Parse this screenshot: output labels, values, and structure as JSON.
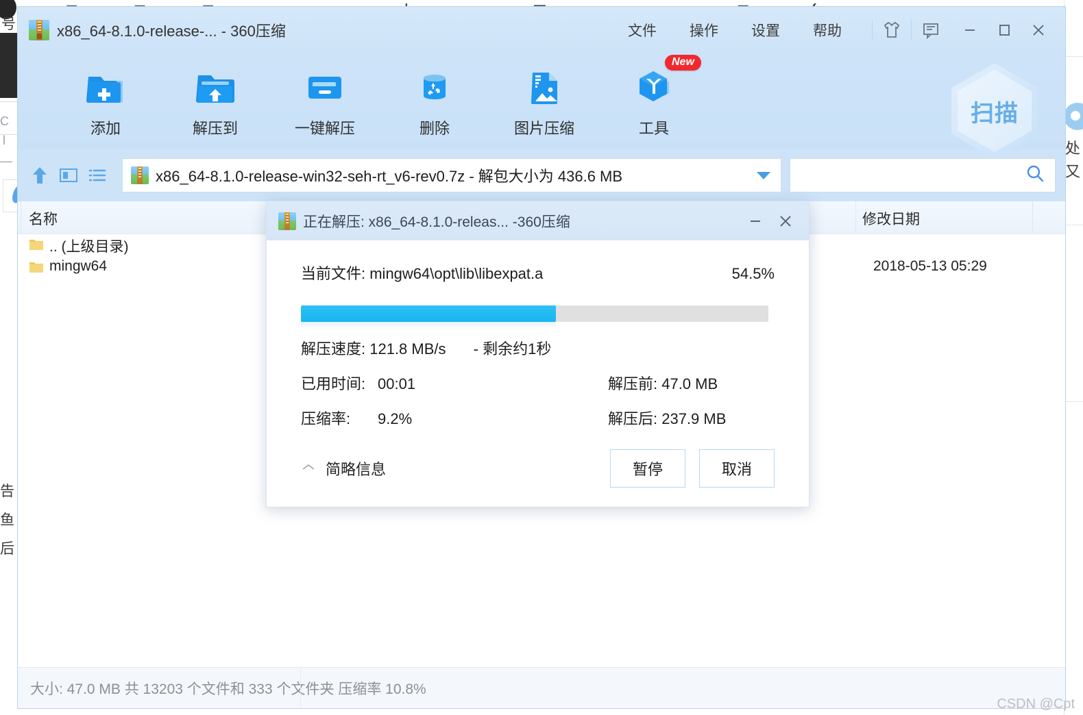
{
  "background": {
    "left_fragments": [
      "号",
      "C",
      "l",
      "—",
      "告",
      "鱼",
      "后"
    ],
    "right_fragments": [
      "处",
      "又"
    ],
    "top_glyph_row": "⌐ ⊓ ⊓ ⊓ ∧ ∧ ǀ ⊿ ⊞ ∧ ∧ ⊓ ∠"
  },
  "window": {
    "title": "x86_64-8.1.0-release-... - 360压缩",
    "app_icon": "archive-icon",
    "menu": [
      {
        "label": "文件",
        "name": "menu-file"
      },
      {
        "label": "操作",
        "name": "menu-action"
      },
      {
        "label": "设置",
        "name": "menu-settings"
      },
      {
        "label": "帮助",
        "name": "menu-help"
      }
    ],
    "title_icons": [
      {
        "name": "skin-icon",
        "glyph": "skin"
      },
      {
        "name": "feedback-icon",
        "glyph": "feedback"
      }
    ],
    "window_buttons": [
      {
        "name": "minimize-button",
        "glyph": "−"
      },
      {
        "name": "maximize-button",
        "glyph": "□"
      },
      {
        "name": "close-button",
        "glyph": "✕"
      }
    ]
  },
  "toolbar": {
    "items": [
      {
        "label": "添加",
        "icon": "folder-add-icon"
      },
      {
        "label": "解压到",
        "icon": "folder-extract-icon"
      },
      {
        "label": "一键解压",
        "icon": "one-click-extract-icon"
      },
      {
        "label": "删除",
        "icon": "recycle-bin-icon"
      },
      {
        "label": "图片压缩",
        "icon": "image-compress-icon"
      },
      {
        "label": "工具",
        "icon": "tools-hexagon-icon",
        "badge": "New"
      }
    ],
    "scan_watermark": "扫描"
  },
  "addressbar": {
    "up_icon": "up-arrow-icon",
    "view_icon": "preview-pane-icon",
    "list_icon": "list-view-icon",
    "path_text": "x86_64-8.1.0-release-win32-seh-rt_v6-rev0.7z - 解包大小为 436.6 MB",
    "path_icon": "archive-icon",
    "dropdown_icon": "chevron-down-icon",
    "search_value": "",
    "search_placeholder": "",
    "search_icon": "search-icon"
  },
  "filelist": {
    "columns": {
      "name": "名称",
      "date": "修改日期"
    },
    "rows": [
      {
        "name": ".. (上级目录)",
        "date": "",
        "icon": "folder-icon"
      },
      {
        "name": "mingw64",
        "date": "2018-05-13 05:29",
        "icon": "folder-icon"
      }
    ]
  },
  "statusbar": {
    "text": "大小: 47.0 MB 共 13203 个文件和 333 个文件夹 压缩率 10.8%"
  },
  "watermark": "CSDN @Cpt",
  "dialog": {
    "title": "正在解压: x86_64-8.1.0-releas... -360压缩",
    "icon": "archive-icon",
    "minimize": "−",
    "close": "✕",
    "current_file_label": "当前文件: mingw64\\opt\\lib\\libexpat.a",
    "percent_text": "54.5%",
    "progress_percent": 54.5,
    "progress_color": "#19b5f0",
    "speed_line": "解压速度: 121.8 MB/s",
    "remaining_line": "- 剩余约1秒",
    "elapsed_label": "已用时间:",
    "elapsed_value": "00:01",
    "ratio_label": "压缩率:",
    "ratio_value": "9.2%",
    "before_line": "解压前: 47.0 MB",
    "after_line": "解压后: 237.9 MB",
    "brief_label": "简略信息",
    "brief_icon": "chevron-up-icon",
    "pause_button": "暂停",
    "cancel_button": "取消"
  }
}
